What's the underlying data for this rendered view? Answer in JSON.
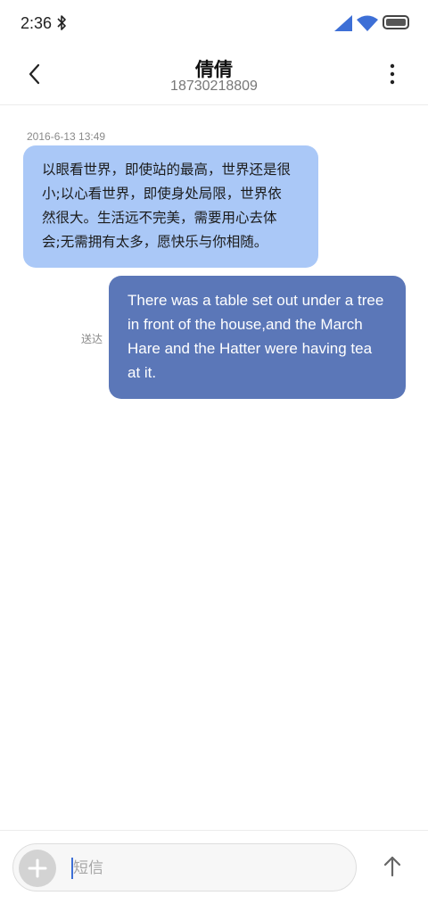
{
  "status_bar": {
    "time": "2:36",
    "icons": [
      "bluetooth-icon",
      "signal-icon",
      "wifi-icon",
      "battery-icon"
    ],
    "accent_color": "#3d6fd6"
  },
  "header": {
    "contact_name": "倩倩",
    "contact_number": "18730218809",
    "back_icon": "chevron-left-icon",
    "menu_icon": "more-vertical-icon"
  },
  "conversation": {
    "timestamp": "2016-6-13 13:49",
    "messages": [
      {
        "direction": "incoming",
        "lines": [
          "以眼看世界，即使站的最高，世界还是很",
          "小;以心看世界，即使身处局限，世界依",
          "然很大。生活远不完美，需要用心去体",
          "会;无需拥有太多，愿快乐与你相随。"
        ],
        "color": "#aac8f7"
      },
      {
        "direction": "outgoing",
        "lines": [
          "There was a table set out under a tree",
          "in front of the house,and the March",
          "Hare and the Hatter were having tea",
          "at it."
        ],
        "status": "送达",
        "color": "#5b77b8"
      }
    ]
  },
  "composer": {
    "placeholder": "短信",
    "value": "",
    "add_icon": "plus-icon",
    "send_icon": "arrow-up-icon"
  }
}
